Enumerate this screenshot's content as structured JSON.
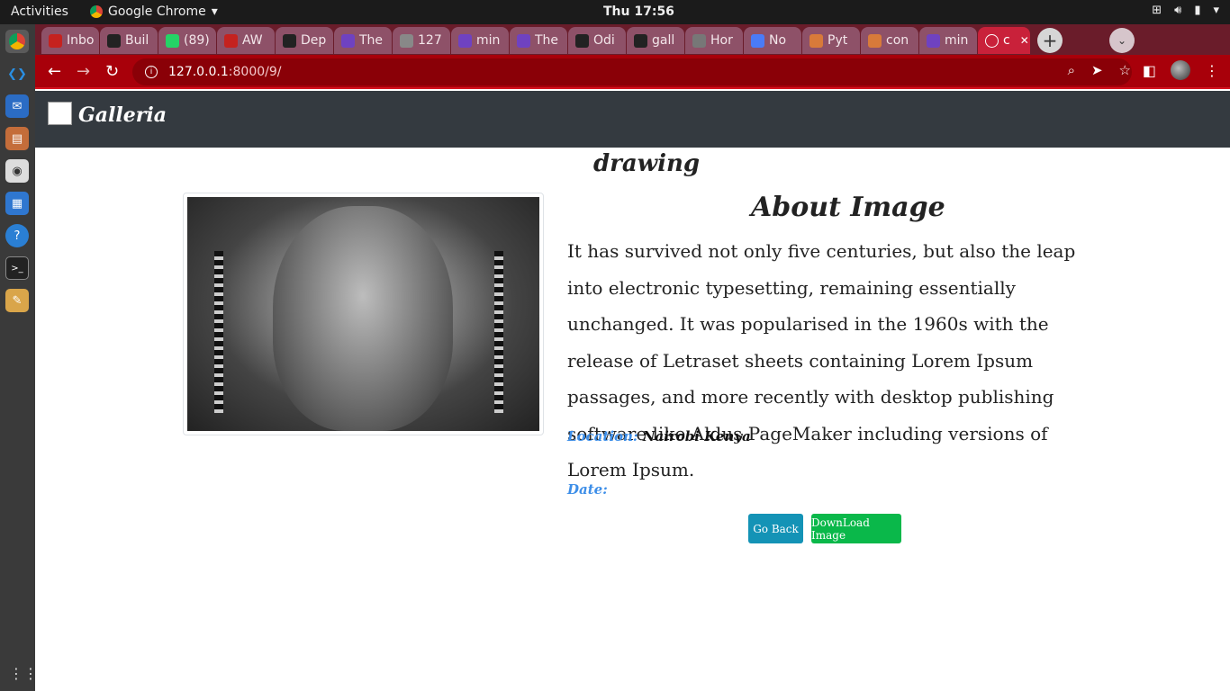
{
  "system": {
    "activities": "Activities",
    "app_name": "Google Chrome",
    "clock": "Thu 17:56"
  },
  "browser": {
    "tabs": [
      {
        "label": "Inbo",
        "icon": "gmail-icon",
        "color": "#c5221f"
      },
      {
        "label": "Buil",
        "icon": "buildkite-icon",
        "color": "#222222"
      },
      {
        "label": "(89)",
        "icon": "whatsapp-icon",
        "color": "#25d366"
      },
      {
        "label": "AW",
        "icon": "gmail-icon",
        "color": "#c5221f"
      },
      {
        "label": "Dep",
        "icon": "github-icon",
        "color": "#222222"
      },
      {
        "label": "The",
        "icon": "heroku-icon",
        "color": "#6f42c1"
      },
      {
        "label": "127",
        "icon": "loading-icon",
        "color": "#888888"
      },
      {
        "label": "min",
        "icon": "heroku-icon",
        "color": "#6f42c1"
      },
      {
        "label": "The",
        "icon": "heroku-icon",
        "color": "#6f42c1"
      },
      {
        "label": "Odi",
        "icon": "github-icon",
        "color": "#222222"
      },
      {
        "label": "gall",
        "icon": "github-icon",
        "color": "#222222"
      },
      {
        "label": "Hor",
        "icon": "globe-icon",
        "color": "#777777"
      },
      {
        "label": "No",
        "icon": "circle-icon",
        "color": "#4a7bf7"
      },
      {
        "label": "Pyt",
        "icon": "python-icon",
        "color": "#d87a3a"
      },
      {
        "label": "con",
        "icon": "python-icon",
        "color": "#d87a3a"
      },
      {
        "label": "min",
        "icon": "heroku-icon",
        "color": "#6f42c1"
      },
      {
        "label": "c",
        "icon": "globe-icon",
        "color": "#ffffff",
        "active": true
      }
    ],
    "url_host": "127.0.0.1",
    "url_path": ":8000/9/"
  },
  "site": {
    "brand": "Galleria",
    "image_title": "drawing",
    "about_title": "About Image",
    "description": "It has survived not only five centuries, but also the leap into electronic typesetting, remaining essentially unchanged. It was popularised in the 1960s with the release of Letraset sheets containing Lorem Ipsum passages, and more recently with desktop publishing software like Aldus PageMaker including versions of Lorem Ipsum.",
    "location_label": "Location:",
    "location_value": "Nairobi Kenya",
    "date_label": "Date:",
    "date_value": "",
    "go_back_label": "Go Back",
    "download_label": "DownLoad Image"
  },
  "colors": {
    "navbar": "#343a40",
    "chrome_theme": "#a8000a",
    "meta_label": "#3d8ee8",
    "go_back": "#1493b6",
    "download": "#0ab84a"
  }
}
